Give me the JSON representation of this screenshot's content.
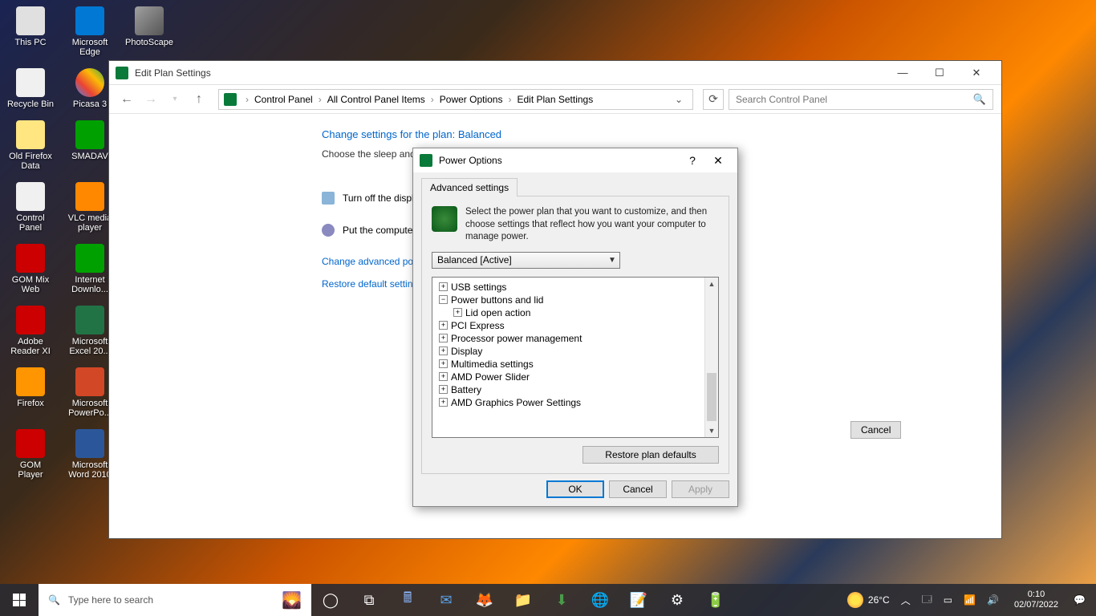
{
  "desktop": {
    "icons": [
      [
        {
          "name": "This PC",
          "cls": "pc"
        },
        {
          "name": "Microsoft Edge",
          "cls": "edge"
        },
        {
          "name": "PhotoScape",
          "cls": "photo"
        }
      ],
      [
        {
          "name": "Recycle Bin",
          "cls": "recycle"
        },
        {
          "name": "Picasa 3",
          "cls": "picasa"
        }
      ],
      [
        {
          "name": "Old Firefox Data",
          "cls": "firefox-data"
        },
        {
          "name": "SMADAV",
          "cls": "smadav"
        }
      ],
      [
        {
          "name": "Control Panel",
          "cls": "control"
        },
        {
          "name": "VLC media player",
          "cls": "vlc"
        }
      ],
      [
        {
          "name": "GOM Mix Web",
          "cls": "gommix"
        },
        {
          "name": "Internet Downlo...",
          "cls": "idm"
        }
      ],
      [
        {
          "name": "Adobe Reader XI",
          "cls": "adobe"
        },
        {
          "name": "Microsoft Excel 20...",
          "cls": "excel"
        }
      ],
      [
        {
          "name": "Firefox",
          "cls": "firefox"
        },
        {
          "name": "Microsoft PowerPo...",
          "cls": "ppt"
        }
      ],
      [
        {
          "name": "GOM Player",
          "cls": "gomplayer"
        },
        {
          "name": "Microsoft Word 2010",
          "cls": "word"
        }
      ]
    ]
  },
  "cp_window": {
    "title": "Edit Plan Settings",
    "breadcrumb": [
      "Control Panel",
      "All Control Panel Items",
      "Power Options",
      "Edit Plan Settings"
    ],
    "search_placeholder": "Search Control Panel",
    "heading": "Change settings for the plan: Balanced",
    "subtext": "Choose the sleep and",
    "setting1": "Turn off the displa",
    "setting2": "Put the computer",
    "link_advanced": "Change advanced pow",
    "link_restore": "Restore default setting",
    "cancel": "Cancel"
  },
  "po_dialog": {
    "title": "Power Options",
    "tab": "Advanced settings",
    "description": "Select the power plan that you want to customize, and then choose settings that reflect how you want your computer to manage power.",
    "dropdown": "Balanced [Active]",
    "tree": [
      {
        "label": "USB settings",
        "expanded": false
      },
      {
        "label": "Power buttons and lid",
        "expanded": true,
        "children": [
          {
            "label": "Lid open action",
            "expanded": false
          }
        ]
      },
      {
        "label": "PCI Express",
        "expanded": false
      },
      {
        "label": "Processor power management",
        "expanded": false
      },
      {
        "label": "Display",
        "expanded": false
      },
      {
        "label": "Multimedia settings",
        "expanded": false
      },
      {
        "label": "AMD Power Slider",
        "expanded": false
      },
      {
        "label": "Battery",
        "expanded": false
      },
      {
        "label": "AMD Graphics Power Settings",
        "expanded": false
      }
    ],
    "restore_button": "Restore plan defaults",
    "ok": "OK",
    "cancel": "Cancel",
    "apply": "Apply"
  },
  "taskbar": {
    "search_placeholder": "Type here to search",
    "weather_temp": "26°C",
    "time": "0:10",
    "date": "02/07/2022"
  }
}
